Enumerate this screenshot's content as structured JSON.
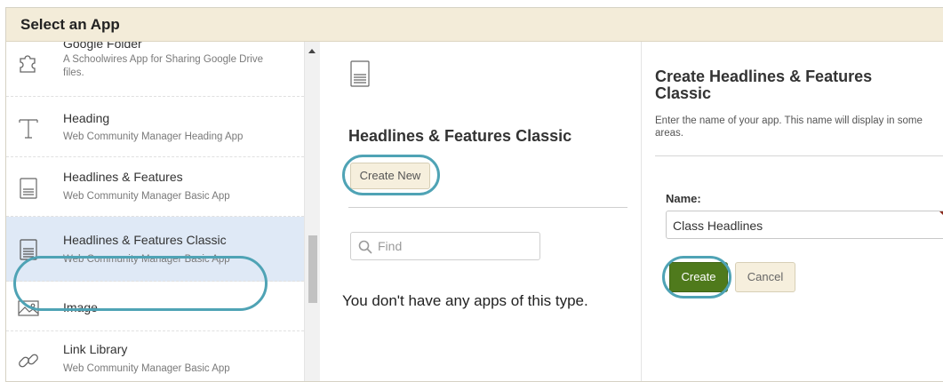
{
  "dialog": {
    "title": "Select an App"
  },
  "app_list": [
    {
      "icon": "puzzle-icon",
      "name": "Google Folder",
      "description": "A Schoolwires App for Sharing Google Drive files."
    },
    {
      "icon": "heading-t-icon",
      "name": "Heading",
      "description": "Web Community Manager Heading App"
    },
    {
      "icon": "document-lines-icon",
      "name": "Headlines & Features",
      "description": "Web Community Manager Basic App"
    },
    {
      "icon": "document-lines-icon",
      "name": "Headlines & Features Classic",
      "description": "Web Community Manager Basic App",
      "selected": true
    },
    {
      "icon": "image-icon",
      "name": "Image",
      "description": ""
    },
    {
      "icon": "link-chain-icon",
      "name": "Link Library",
      "description": "Web Community Manager Basic App"
    }
  ],
  "middle": {
    "title": "Headlines & Features Classic",
    "create_new_label": "Create New",
    "find_placeholder": "Find",
    "empty_message": "You don't have any apps of this type."
  },
  "right": {
    "title": "Create Headlines & Features Classic",
    "description": "Enter the name of your app. This name will display in some areas.",
    "name_label": "Name:",
    "name_value": "Class Headlines",
    "create_label": "Create",
    "cancel_label": "Cancel"
  },
  "colors": {
    "titlebar_bg": "#f3ecd9",
    "selected_row_bg": "#dfe9f6",
    "highlight_ring": "#4fa3b5",
    "create_button": "#4f7a1c",
    "secondary_button": "#f6efdd"
  }
}
